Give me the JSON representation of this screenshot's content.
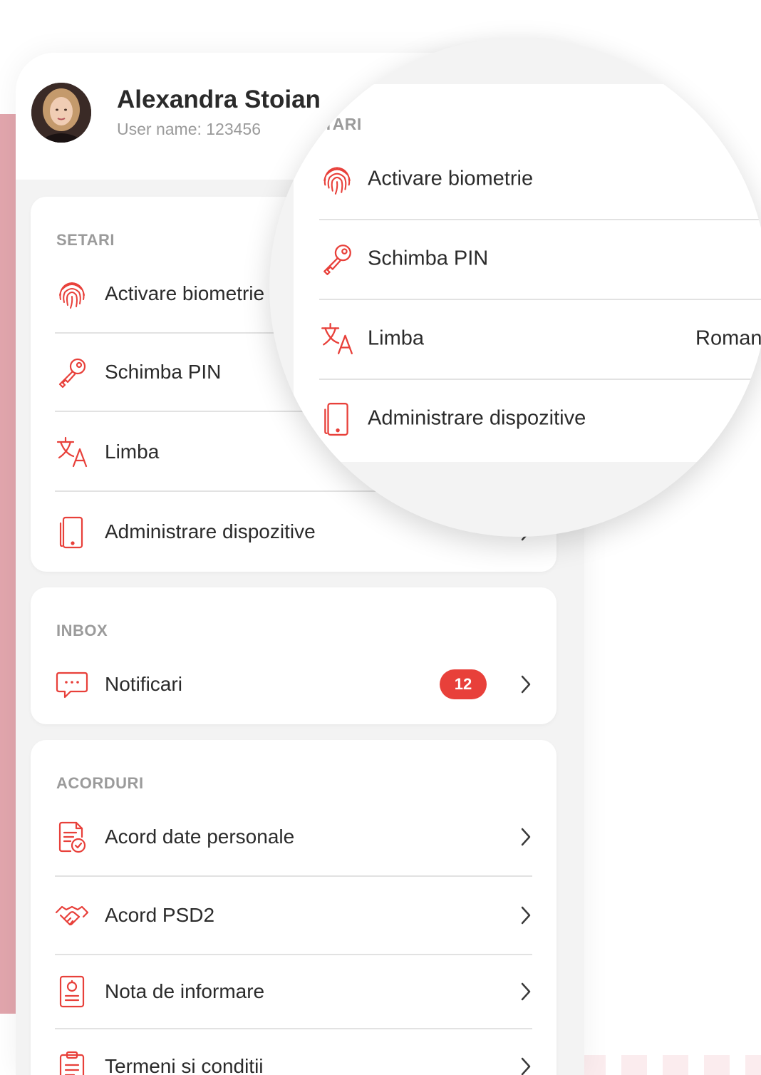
{
  "profile": {
    "name": "Alexandra Stoian",
    "username": "User name: 123456"
  },
  "settings": {
    "title": "SETARI",
    "items": [
      {
        "label": "Activare biometrie",
        "icon": "fingerprint-icon"
      },
      {
        "label": "Schimba PIN",
        "icon": "key-icon"
      },
      {
        "label": "Limba",
        "icon": "translate-icon",
        "value": "Roman"
      },
      {
        "label": "Administrare dispozitive",
        "icon": "device-icon"
      }
    ],
    "magnifier_title": "ETARI"
  },
  "inbox": {
    "title": "INBOX",
    "items": [
      {
        "label": "Notificari",
        "icon": "chat-icon",
        "badge": "12"
      }
    ]
  },
  "agreements": {
    "title": "ACORDURI",
    "items": [
      {
        "label": "Acord date personale",
        "icon": "document-check-icon"
      },
      {
        "label": "Acord PSD2",
        "icon": "handshake-icon"
      },
      {
        "label": "Nota de informare",
        "icon": "info-note-icon"
      },
      {
        "label": "Termeni si conditii",
        "icon": "clipboard-icon"
      }
    ]
  },
  "colors": {
    "accent": "#e8403a",
    "toggle_on": "#3dbf55",
    "stripe": "#e2a6ad"
  },
  "toggles": {
    "biometrics_on": true
  }
}
